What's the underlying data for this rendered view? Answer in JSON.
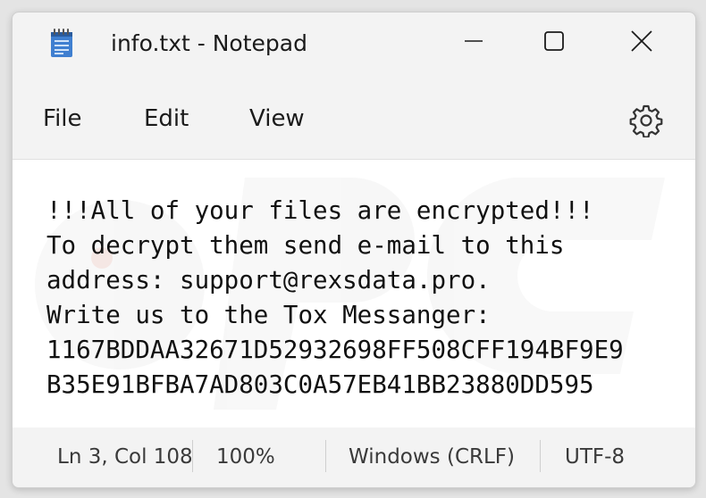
{
  "window": {
    "title": "info.txt - Notepad",
    "app_icon": "notepad-icon",
    "controls": [
      "minimize-icon",
      "maximize-icon",
      "close-icon"
    ]
  },
  "menu": {
    "file_label": "File",
    "edit_label": "Edit",
    "view_label": "View",
    "settings_icon": "gear-icon"
  },
  "document": {
    "lines": [
      "!!!All of your files are encrypted!!!",
      "To decrypt them send e-mail to this",
      "address: support@rexsdata.pro.",
      "Write us to the Tox Messanger:",
      "1167BDDAA32671D52932698FF508CFF194BF9E9",
      "B35E91BFBA7AD803C0A57EB41BB23880DD595"
    ]
  },
  "status": {
    "position": "Ln 3, Col 108",
    "zoom": "100%",
    "line_ending": "Windows (CRLF)",
    "encoding": "UTF-8"
  },
  "colors": {
    "window_bg": "#f3f3f3",
    "editor_bg": "#ffffff",
    "text": "#111111",
    "icon_blue": "#2b6cb8"
  }
}
